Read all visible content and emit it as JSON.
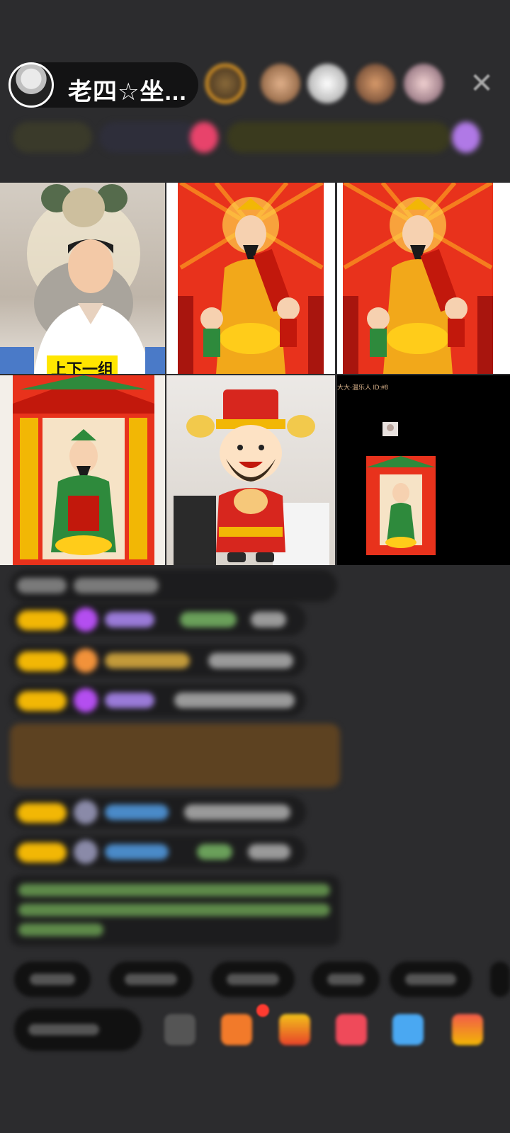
{
  "header": {
    "host_name": "老四☆坐...",
    "close_symbol": "✕",
    "viewer_avatar_icons": [
      "viewer-avatar-1",
      "viewer-avatar-2",
      "viewer-avatar-3",
      "viewer-avatar-4",
      "viewer-avatar-5"
    ]
  },
  "grid": {
    "host_tile_caption": "上下一组",
    "tile_6_caption": "大大·温乐人 ID:#8"
  },
  "colors": {
    "background": "#2c2c2e",
    "level_badge": "#f2b705",
    "caption_bg": "#ffe600",
    "amber_notice": "#6e4a1e"
  }
}
